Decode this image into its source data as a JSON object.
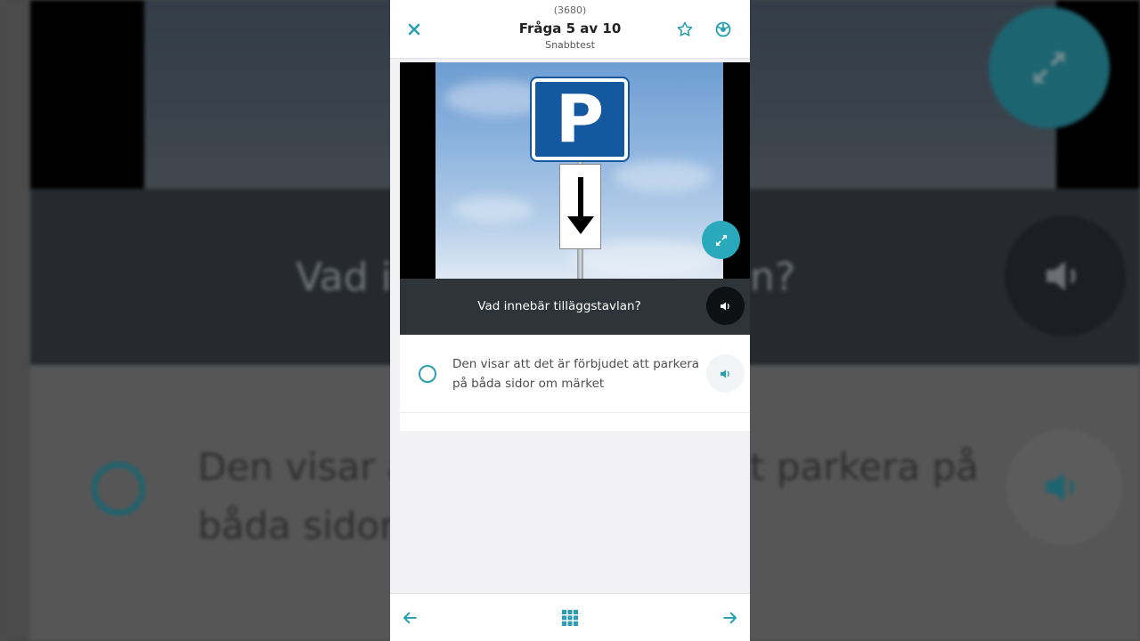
{
  "header": {
    "question_id": "(3680)",
    "title": "Fråga 5 av 10",
    "subtitle": "Snabbtest"
  },
  "question": {
    "text": "Vad innebär tilläggstavlan?",
    "sign_letter": "P"
  },
  "answers": [
    {
      "text": "Den visar att det är förbjudet att parkera på båda sidor om märket",
      "selected": false
    }
  ],
  "background": {
    "question_left": "Vad in",
    "question_right": "n?",
    "answer_left_line1": "Den visar a",
    "answer_left_line2": "båda sidor",
    "answer_right_line1": "t parkera på"
  },
  "colors": {
    "accent": "#2aa9bd",
    "sign_blue": "#1458a0",
    "question_bar": "#2f3438"
  },
  "icons": {
    "close": "close-icon",
    "favorite": "star-icon",
    "settings": "settings-icon",
    "expand": "expand-icon",
    "speaker": "speaker-icon",
    "prev": "arrow-left-icon",
    "grid": "grid-icon",
    "next": "arrow-right-icon"
  }
}
